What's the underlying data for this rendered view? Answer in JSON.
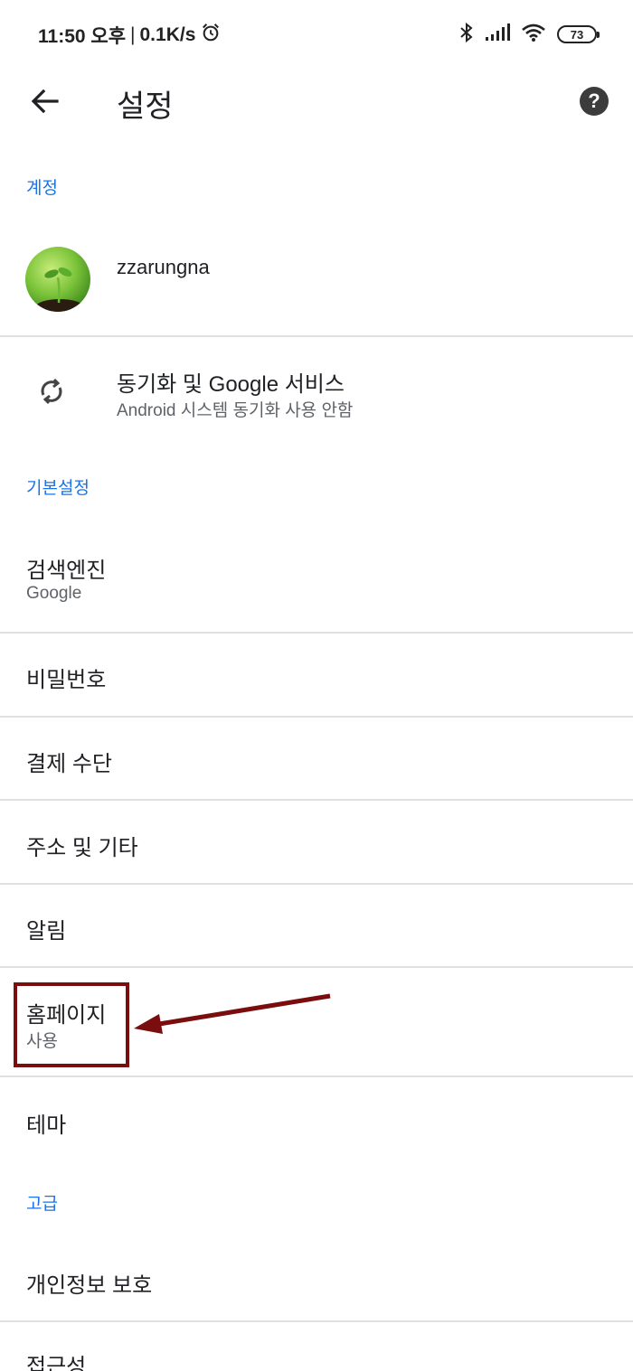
{
  "status_bar": {
    "time": "11:50 오후",
    "speed": "0.1K/s",
    "battery": "73",
    "icons": [
      "alarm-icon",
      "bluetooth-icon",
      "signal-icon",
      "wifi-icon",
      "battery-icon"
    ]
  },
  "app_bar": {
    "title": "설정",
    "back_icon": "arrow-back-icon",
    "help_icon": "help-icon",
    "help_glyph": "?"
  },
  "sections": {
    "account": "계정",
    "basic": "기본설정",
    "advanced": "고급"
  },
  "account": {
    "username": "zzarungna"
  },
  "sync": {
    "title": "동기화 및 Google 서비스",
    "subtitle": "Android 시스템 동기화 사용 안함",
    "icon": "sync-icon"
  },
  "settings": {
    "search_engine": {
      "title": "검색엔진",
      "subtitle": "Google"
    },
    "passwords": {
      "title": "비밀번호"
    },
    "payment": {
      "title": "결제 수단"
    },
    "addresses": {
      "title": "주소 및 기타"
    },
    "notifications": {
      "title": "알림"
    },
    "homepage": {
      "title": "홈페이지",
      "subtitle": "사용"
    },
    "theme": {
      "title": "테마"
    },
    "privacy": {
      "title": "개인정보 보호"
    },
    "accessibility": {
      "title": "접근성"
    }
  },
  "colors": {
    "accent": "#1a73e8",
    "annotation": "#7a0d0d",
    "divider": "#e0e0e0"
  }
}
